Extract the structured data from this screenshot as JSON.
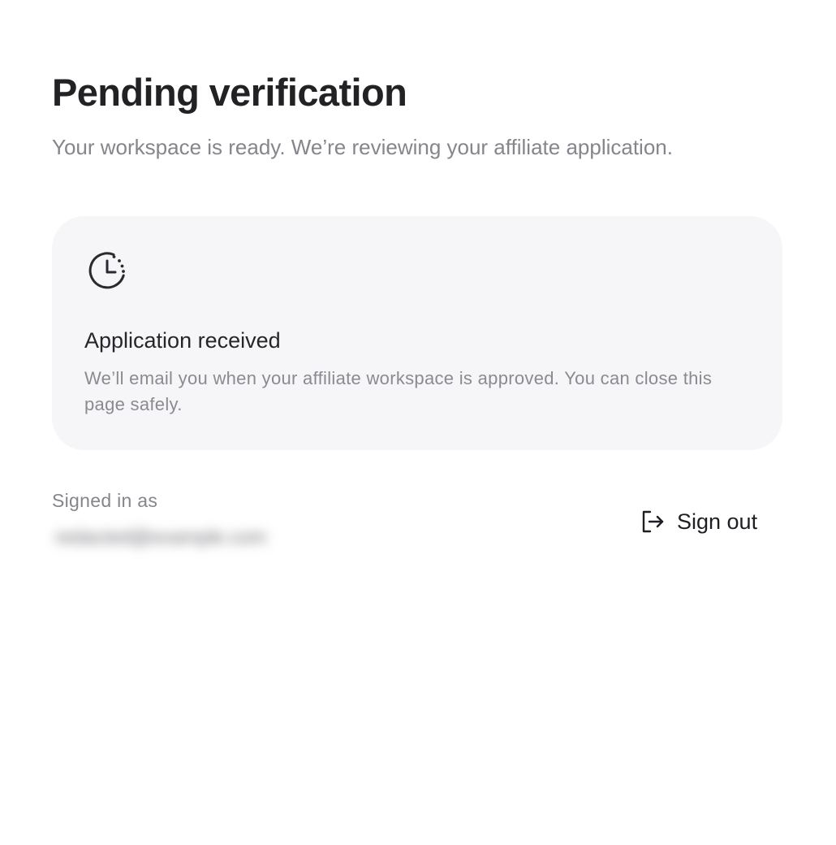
{
  "header": {
    "title": "Pending verification",
    "subtitle": "Your workspace is ready. We’re reviewing your affiliate application."
  },
  "status_card": {
    "icon": "clock-pending-icon",
    "heading": "Application received",
    "body": "We’ll email you when your affiliate workspace is approved. You can close this page safely."
  },
  "account": {
    "signed_in_label": "Signed in as",
    "email": "redacted@example.com"
  },
  "actions": {
    "sign_out_label": "Sign out",
    "sign_out_icon": "log-out-icon"
  },
  "colors": {
    "card_background": "#f6f6f8",
    "muted_text": "#85858c",
    "primary_text": "#222225"
  }
}
